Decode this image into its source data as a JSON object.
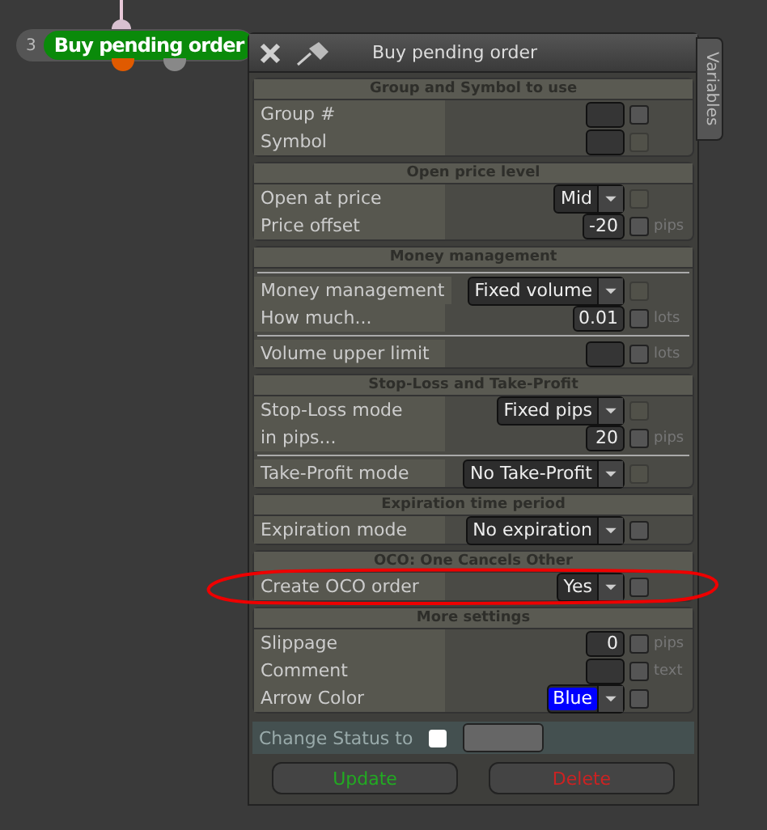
{
  "node": {
    "number": "3",
    "label": "Buy pending order"
  },
  "dialog": {
    "title": "Buy pending order",
    "side_tab": "Variables",
    "sections": [
      {
        "title": "Group and Symbol to use",
        "rows": [
          {
            "label": "Group #",
            "kind": "field",
            "check_enabled": true
          },
          {
            "label": "Symbol",
            "kind": "field",
            "check_enabled": false
          }
        ]
      },
      {
        "title": "Open price level",
        "rows": [
          {
            "label": "Open at price",
            "kind": "select",
            "value": "Mid",
            "check_enabled": false
          },
          {
            "label": "Price offset",
            "kind": "field",
            "value": "-20",
            "unit": "pips",
            "check_enabled": true
          }
        ]
      },
      {
        "title": "Money management",
        "rows": [
          {
            "label": "Money management",
            "kind": "select",
            "value": "Fixed volume",
            "check_enabled": false,
            "divider_before": true
          },
          {
            "label": "How much...",
            "kind": "field",
            "value": "0.01",
            "unit": "lots",
            "check_enabled": true
          },
          {
            "label": "Volume upper limit",
            "kind": "field",
            "unit": "lots",
            "check_enabled": true,
            "divider_before": true
          }
        ]
      },
      {
        "title": "Stop-Loss and Take-Profit",
        "rows": [
          {
            "label": "Stop-Loss mode",
            "kind": "select",
            "value": "Fixed pips",
            "check_enabled": false
          },
          {
            "label": "in pips...",
            "kind": "field",
            "value": "20",
            "unit": "pips",
            "check_enabled": true
          },
          {
            "label": "Take-Profit mode",
            "kind": "select",
            "value": "No Take-Profit",
            "check_enabled": false,
            "divider_before": true
          }
        ]
      },
      {
        "title": "Expiration time period",
        "rows": [
          {
            "label": "Expiration mode",
            "kind": "select",
            "value": "No expiration",
            "check_enabled": true
          }
        ]
      },
      {
        "title": "OCO: One Cancels Other",
        "rows": [
          {
            "label": "Create OCO order",
            "kind": "select",
            "value": "Yes",
            "check_enabled": true
          }
        ]
      },
      {
        "title": "More settings",
        "rows": [
          {
            "label": "Slippage",
            "kind": "field",
            "value": "0",
            "unit": "pips",
            "check_enabled": true
          },
          {
            "label": "Comment",
            "kind": "field",
            "unit": "text",
            "check_enabled": true
          },
          {
            "label": "Arrow Color",
            "kind": "select",
            "value": "Blue",
            "color": "#0000ff",
            "check_enabled": true
          }
        ]
      }
    ],
    "status": {
      "label": "Change Status to",
      "checked": false
    },
    "buttons": [
      {
        "label": "Update",
        "kind": "confirm"
      },
      {
        "label": "Delete",
        "kind": "danger"
      }
    ]
  }
}
